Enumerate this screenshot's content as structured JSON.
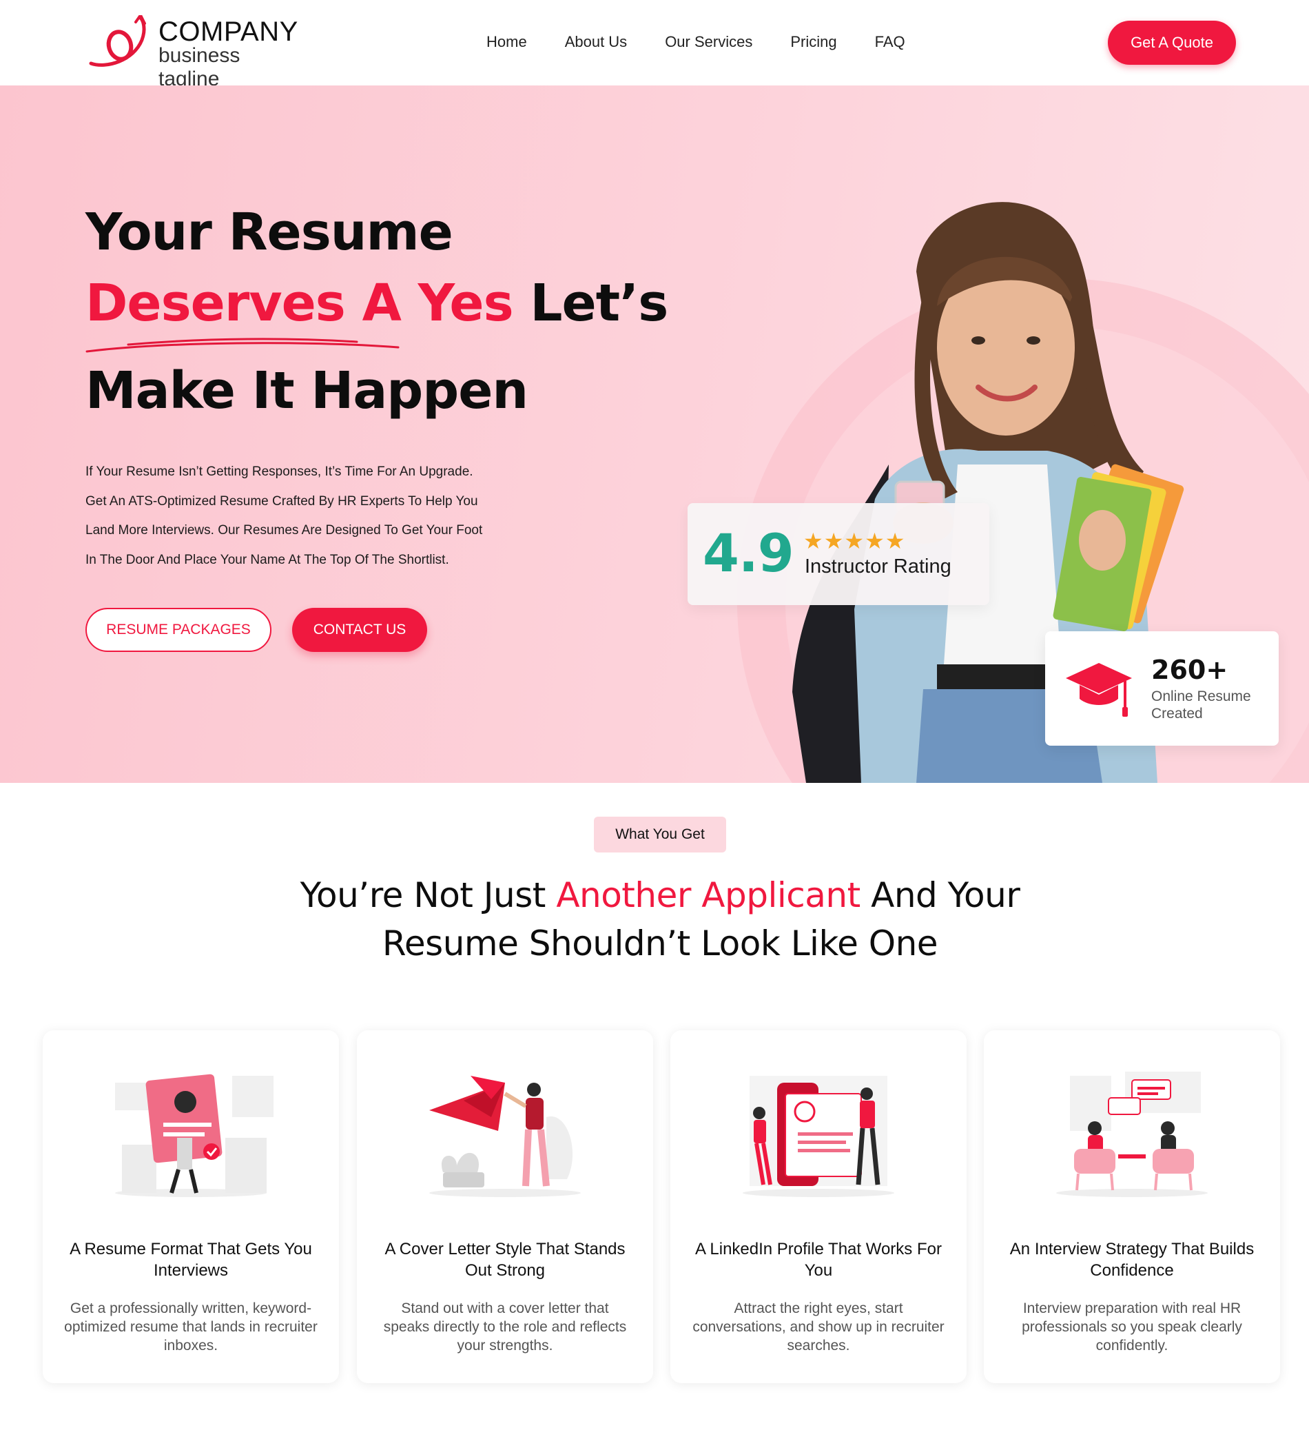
{
  "header": {
    "logo": {
      "company": "COMPANY",
      "tagline": "business tagline"
    },
    "nav": [
      "Home",
      "About Us",
      "Our Services",
      "Pricing",
      "FAQ"
    ],
    "cta": "Get A Quote"
  },
  "hero": {
    "line1": "Your Resume",
    "line2_accent": "Deserves A Yes",
    "line2_rest": "Let’s",
    "line3": "Make It Happen",
    "description": [
      "If Your Resume Isn’t Getting Responses, It’s Time For An Upgrade.",
      "Get An ATS-Optimized Resume Crafted By HR Experts To Help You",
      "Land More Interviews. Our Resumes Are Designed To Get Your Foot",
      "In The Door And Place Your Name At The Top Of The Shortlist."
    ],
    "btn_packages": "RESUME PACKAGES",
    "btn_contact": "CONTACT US",
    "rating": {
      "value": "4.9",
      "stars": "★★★★★",
      "label": "Instructor Rating"
    },
    "stat": {
      "value": "260+",
      "label": "Online Resume Created"
    }
  },
  "features": {
    "pill": "What You Get",
    "title_part1": "You’re Not Just",
    "title_accent": "Another Applicant",
    "title_part2": "And Your",
    "title_line2": "Resume Shouldn’t Look Like One",
    "cards": [
      {
        "title": "A Resume Format That Gets You Interviews",
        "desc": "Get a professionally written, keyword-optimized resume that lands in recruiter inboxes."
      },
      {
        "title": "A Cover Letter Style That Stands Out Strong",
        "desc": "Stand out with a cover letter that speaks directly to the role and reflects your strengths."
      },
      {
        "title": "A LinkedIn Profile That Works For You",
        "desc": "Attract the right eyes, start conversations, and show up in recruiter searches."
      },
      {
        "title": "An Interview Strategy That Builds Confidence",
        "desc": "Interview preparation with real HR professionals so you speak clearly confidently."
      }
    ]
  },
  "colors": {
    "accent": "#f0183f",
    "rating": "#21a88e",
    "hero_bg": "#fcc5cf",
    "star": "#f5a623"
  }
}
